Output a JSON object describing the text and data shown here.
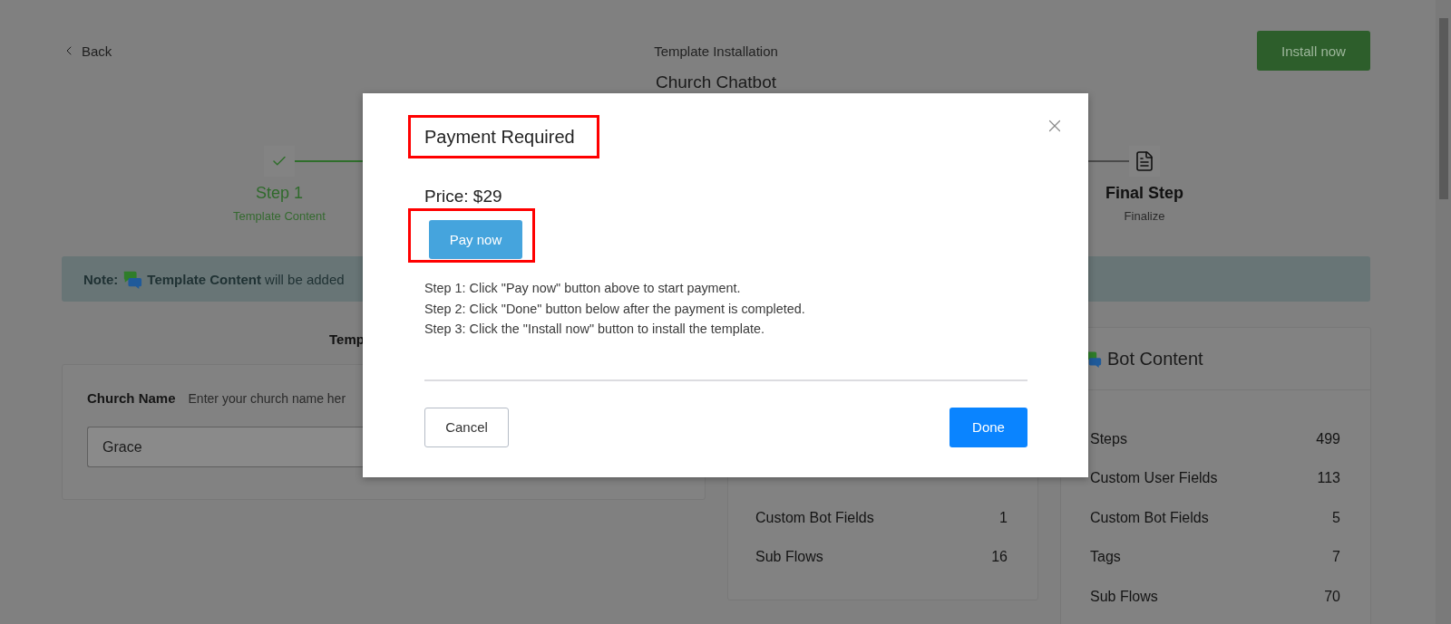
{
  "header": {
    "back": "Back",
    "title": "Template Installation",
    "install_button": "Install now"
  },
  "template_name": "Church Chatbot",
  "steps": [
    {
      "label": "Step 1",
      "caption": "Template Content",
      "done": true
    },
    {
      "label": "Final Step",
      "caption": "Finalize",
      "done": false
    }
  ],
  "note": {
    "label": "Note:",
    "text": "**Template Content** will be added"
  },
  "fields_heading": "Temp",
  "fields": [
    {
      "label": "Church Name",
      "hint": "Enter your church name her",
      "value": "Grace"
    }
  ],
  "summary_card": {
    "rows": [
      {
        "label": "Custom Bot Fields",
        "count": "1"
      },
      {
        "label": "Sub Flows",
        "count": "16"
      }
    ]
  },
  "bot_content": {
    "title": "Bot Content",
    "rows": [
      {
        "label": "Steps",
        "count": "499"
      },
      {
        "label": "Custom User Fields",
        "count": "113"
      },
      {
        "label": "Custom Bot Fields",
        "count": "5"
      },
      {
        "label": "Tags",
        "count": "7"
      },
      {
        "label": "Sub Flows",
        "count": "70"
      }
    ]
  },
  "dialog": {
    "title": "Payment Required",
    "title_highlighted": true,
    "price": "Price: $29",
    "pay_button": "Pay now",
    "pay_highlighted": true,
    "instructions": [
      "Step 1: Click \"Pay now\" button above to start payment.",
      "Step 2: Click \"Done\" button below after the payment is completed.",
      "Step 3: Click the \"Install now\" button to install the template."
    ],
    "cancel": "Cancel",
    "done": "Done"
  }
}
